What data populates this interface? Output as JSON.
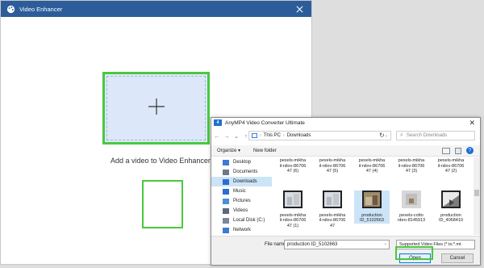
{
  "video_enhancer": {
    "title": "Video Enhancer",
    "add_label": "Add a video to Video Enhancer"
  },
  "dialog": {
    "app_icon_text": "4",
    "title": "AnyMP4 Video Converter Ultimate",
    "close": "✕",
    "address": {
      "root": "This PC",
      "folder": "Downloads"
    },
    "search_placeholder": "Search Downloads",
    "toolbar": {
      "organize": "Organize ▾",
      "new_folder": "New folder"
    },
    "sidebar": [
      {
        "label": "Desktop",
        "icon": "desktop-icon",
        "active": false
      },
      {
        "label": "Documents",
        "icon": "documents-icon",
        "active": false
      },
      {
        "label": "Downloads",
        "icon": "downloads-icon",
        "active": true
      },
      {
        "label": "Music",
        "icon": "music-icon",
        "active": false
      },
      {
        "label": "Pictures",
        "icon": "pictures-icon",
        "active": false
      },
      {
        "label": "Videos",
        "icon": "videos-icon",
        "active": false
      },
      {
        "label": "Local Disk (C:)",
        "icon": "disk-icon",
        "active": false
      },
      {
        "label": "Network",
        "icon": "network-icon",
        "active": false
      }
    ],
    "files_row1": [
      {
        "line1": "pexels-mikha",
        "line2": "il-nilov-86706",
        "line3": "47 (6)"
      },
      {
        "line1": "pexels-mikha",
        "line2": "il-nilov-86706",
        "line3": "47 (5)"
      },
      {
        "line1": "pexels-mikha",
        "line2": "il-nilov-86706",
        "line3": "47 (4)"
      },
      {
        "line1": "pexels-mikha",
        "line2": "il-nilov-86706",
        "line3": "47 (3)"
      },
      {
        "line1": "pexels-mikha",
        "line2": "il-nilov-86706",
        "line3": "47 (2)"
      }
    ],
    "files_row2": [
      {
        "line1": "pexels-mikha",
        "line2": "il-nilov-86706",
        "line3": "47 (1)",
        "selected": false
      },
      {
        "line1": "pexels-mikha",
        "line2": "il-nilov-86706",
        "line3": "47",
        "selected": false
      },
      {
        "line1": "production",
        "line2": "ID_5102663",
        "line3": "",
        "selected": true
      },
      {
        "line1": "pexels-cotto",
        "line2": "nbro-8145913",
        "line3": "",
        "selected": false
      },
      {
        "line1": "production",
        "line2": "ID_4068410",
        "line3": "",
        "selected": false
      }
    ],
    "file_name_label": "File name:",
    "file_name_value": "production ID_5102663",
    "file_type_value": "Supported Video Files (*.ts;*.mt",
    "open_label": "Open",
    "cancel_label": "Cancel"
  },
  "colors": {
    "titlebar": "#2c5d9a",
    "highlight_green": "#48c93f",
    "add_box_fill": "#dce8f9",
    "selection_blue": "#cce4f7"
  }
}
